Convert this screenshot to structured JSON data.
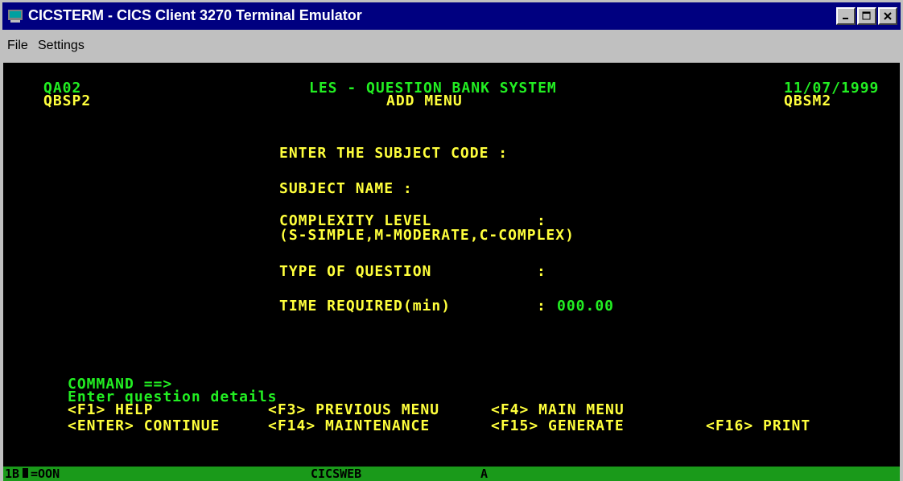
{
  "window": {
    "title": "CICSTERM - CICS Client 3270 Terminal Emulator"
  },
  "menu": {
    "file": "File",
    "settings": "Settings"
  },
  "screen": {
    "header": {
      "left_line1": "QA02",
      "left_line2": "QBSP2",
      "center_line1": "LES - QUESTION BANK SYSTEM",
      "center_line2": "ADD MENU",
      "right_date": "11/07/1999",
      "right_line2": "QBSM2"
    },
    "fields": {
      "subject_code_label": "ENTER THE SUBJECT CODE :",
      "subject_name_label": "SUBJECT NAME :",
      "complexity_label": "COMPLEXITY LEVEL",
      "complexity_colon": ":",
      "complexity_hint": "(S-SIMPLE,M-MODERATE,C-COMPLEX)",
      "type_label": "TYPE OF QUESTION",
      "type_colon": ":",
      "time_label": "TIME REQUIRED(min)",
      "time_colon": ":",
      "time_value": "000.00"
    },
    "command": {
      "label": "COMMAND ==>",
      "message": "Enter question details"
    },
    "keys": {
      "f1": "<F1> HELP",
      "f3": "<F3> PREVIOUS MENU",
      "f4": "<F4> MAIN MENU",
      "enter": "<ENTER> CONTINUE",
      "f14": "<F14> MAINTENANCE",
      "f15": "<F15> GENERATE",
      "f16": "<F16> PRINT"
    }
  },
  "status_bar": {
    "left": "1B",
    "left_rest": "=OON",
    "center": "CICSWEB",
    "indicator": "A"
  },
  "colors": {
    "title_bar": "#000080",
    "screen_bg": "#000000",
    "text_yellow": "#ffff3c",
    "text_green": "#22ee22",
    "status_bar": "#1a9a1a"
  }
}
